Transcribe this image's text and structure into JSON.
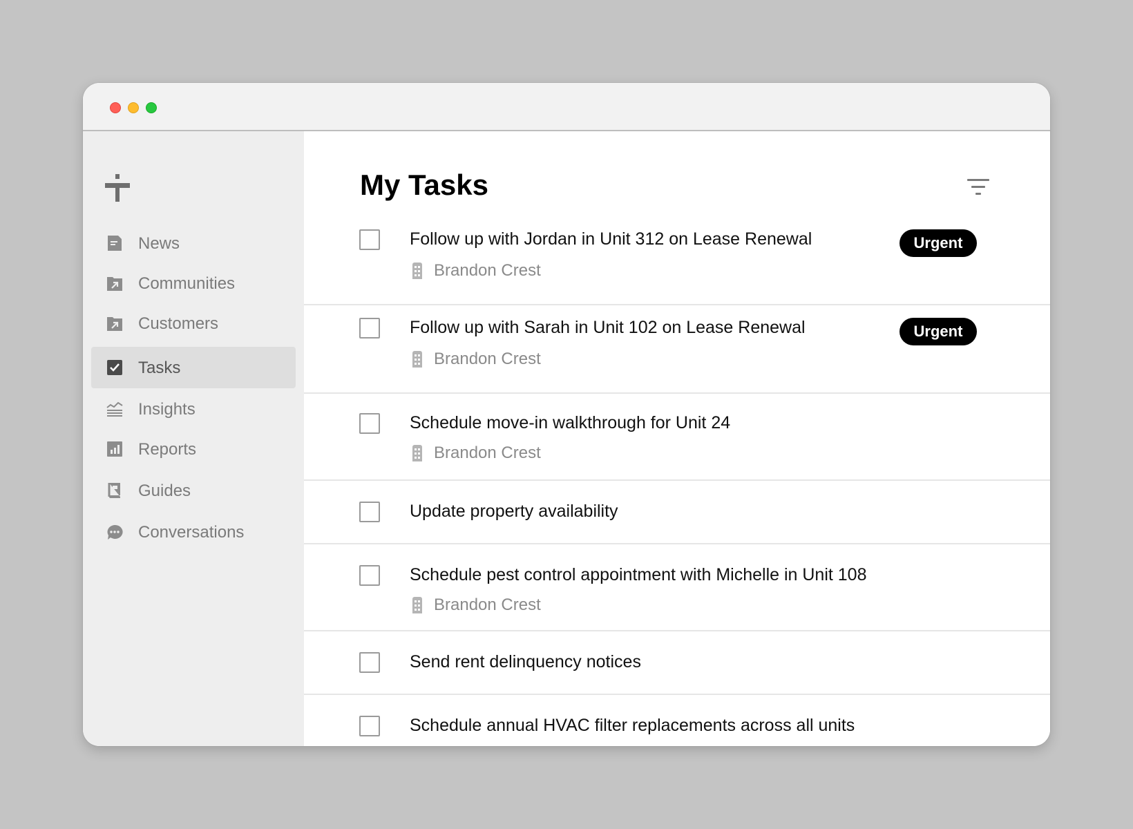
{
  "sidebar": {
    "logo": "logo-mark",
    "items": [
      {
        "label": "News",
        "icon": "document-icon"
      },
      {
        "label": "Communities",
        "icon": "folder-arrow-icon"
      },
      {
        "label": "Customers",
        "icon": "folder-arrow-icon"
      },
      {
        "label": "Tasks",
        "icon": "checkbox-checked-icon",
        "active": true
      },
      {
        "label": "Insights",
        "icon": "insights-chart-icon"
      },
      {
        "label": "Reports",
        "icon": "bar-chart-icon"
      },
      {
        "label": "Guides",
        "icon": "book-icon"
      },
      {
        "label": "Conversations",
        "icon": "chat-bubble-icon"
      }
    ]
  },
  "main": {
    "title": "My Tasks",
    "filter_icon": "filter-icon",
    "tasks": [
      {
        "title": "Follow up with Jordan in Unit 312 on Lease Renewal",
        "community": "Brandon Crest",
        "badge": "Urgent"
      },
      {
        "title": "Follow up with Sarah in Unit 102 on Lease Renewal",
        "community": "Brandon Crest",
        "badge": "Urgent"
      },
      {
        "title": "Schedule move-in walkthrough for Unit 24",
        "community": "Brandon Crest"
      },
      {
        "title": "Update property availability"
      },
      {
        "title": "Schedule pest control appointment with Michelle in Unit 108",
        "community": "Brandon Crest"
      },
      {
        "title": "Send rent delinquency notices"
      },
      {
        "title": "Schedule annual HVAC filter replacements across all units"
      }
    ]
  },
  "colors": {
    "badge_bg": "#000000",
    "sidebar_bg": "#eeeeee",
    "active_item_bg": "#dedede",
    "icon_gray": "#8c8c8c"
  }
}
